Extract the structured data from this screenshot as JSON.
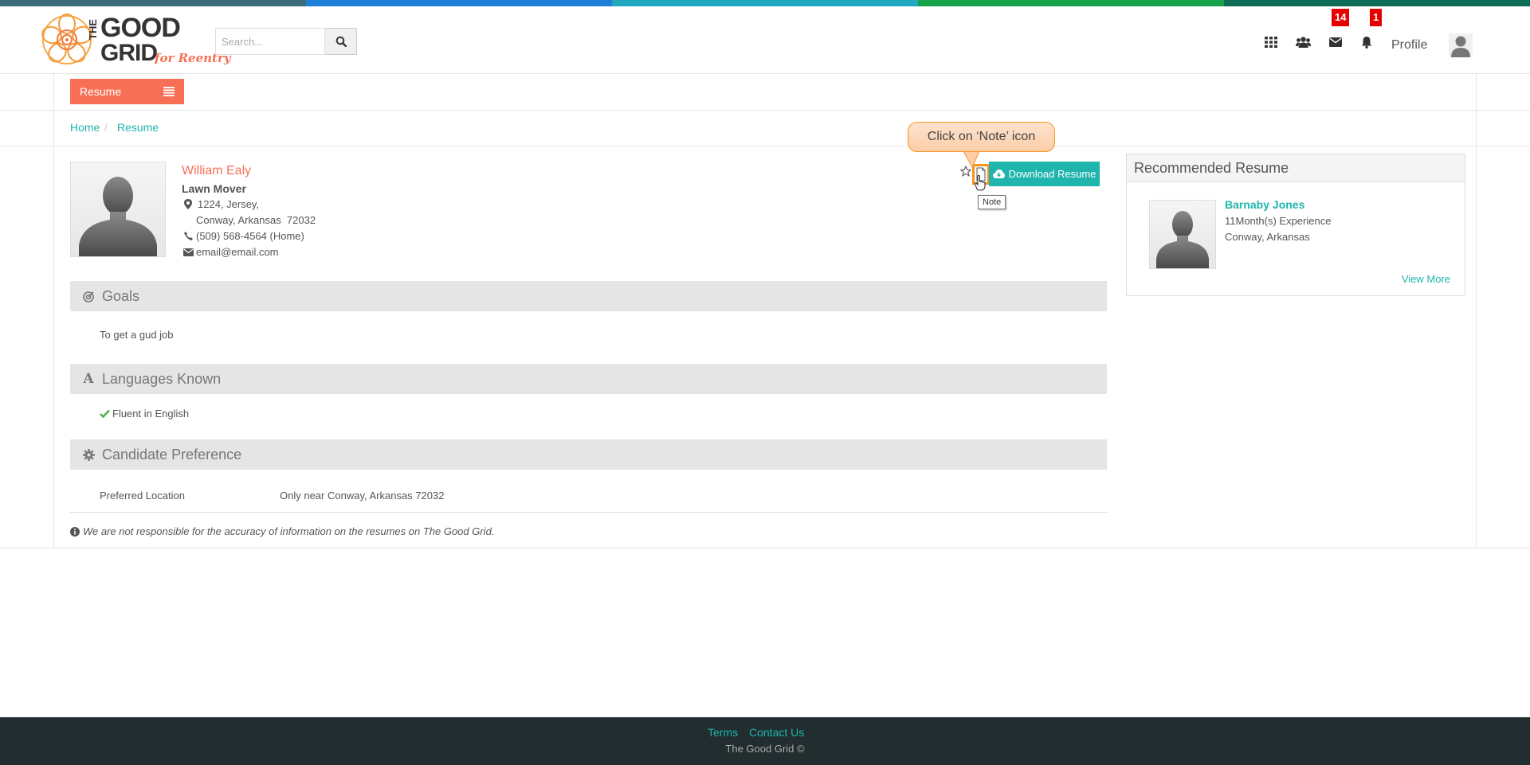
{
  "colors": {
    "top_bar": [
      "#3c6b7a",
      "#1e7fd6",
      "#20a8c0",
      "#17a14a",
      "#0d6c56"
    ],
    "accent_teal": "#1fb5ad",
    "accent_orange": "#f77056",
    "badge_red": "#e60000",
    "footer_bg": "#212d2f"
  },
  "brand": {
    "line1": "THE",
    "line2": "GOOD",
    "line3": "GRID",
    "tagline": "for Reentry"
  },
  "search": {
    "placeholder": "Search..."
  },
  "header": {
    "icons": [
      "apps-grid-icon",
      "users-icon",
      "envelope-icon",
      "bell-icon"
    ],
    "messages_badge": "14",
    "notifications_badge": "1",
    "profile_label": "Profile"
  },
  "tab": {
    "label": "Resume"
  },
  "breadcrumb": {
    "home": "Home",
    "sep": "/",
    "current": "Resume"
  },
  "candidate": {
    "name": "William Ealy",
    "title": "Lawn Mover",
    "address_line1": "1224, Jersey,",
    "address_line2": "Conway, Arkansas  72032",
    "phone": "(509) 568-4564 (Home)",
    "email": "email@email.com"
  },
  "actions": {
    "download_label": "Download Resume",
    "note_tooltip": "Note",
    "callout": "Click on ‘Note’ icon"
  },
  "sections": {
    "goals": {
      "title": "Goals",
      "text": "To get a gud job"
    },
    "languages": {
      "title": "Languages Known",
      "item": "Fluent in English"
    },
    "preference": {
      "title": "Candidate Preference",
      "label": "Preferred Location",
      "value": "Only near Conway, Arkansas 72032"
    }
  },
  "disclaimer": "We are not responsible for the accuracy of information on the resumes on The Good Grid.",
  "recommended": {
    "title": "Recommended Resume",
    "name": "Barnaby Jones",
    "experience": "11Month(s) Experience",
    "location": "Conway, Arkansas",
    "view_more": "View More"
  },
  "footer": {
    "terms": "Terms",
    "contact": "Contact Us",
    "copyright": "The Good Grid ©"
  }
}
